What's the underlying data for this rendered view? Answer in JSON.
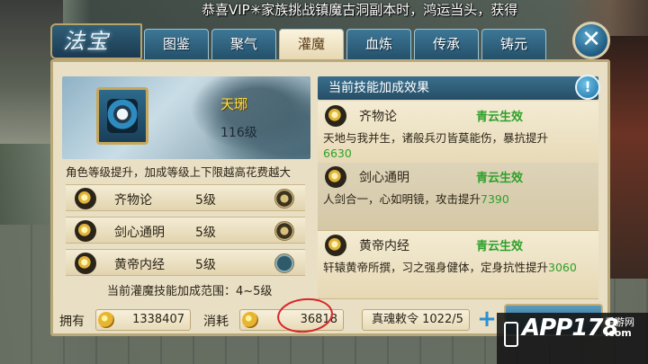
{
  "announcement": "恭喜VIP✳家族挑战镇魔古洞副本时，鸿运当头，获得",
  "logo": "法宝",
  "tabs": [
    {
      "label": "图鉴",
      "active": false
    },
    {
      "label": "聚气",
      "active": false
    },
    {
      "label": "灌魔",
      "active": true
    },
    {
      "label": "血炼",
      "active": false
    },
    {
      "label": "传承",
      "active": false
    },
    {
      "label": "铸元",
      "active": false
    }
  ],
  "close_symbol": "✕",
  "item": {
    "name": "天琊",
    "level": "116级"
  },
  "hint": "角色等级提升，加成等级上下限越高花费越大",
  "skills": [
    {
      "name": "齐物论",
      "level": "5级"
    },
    {
      "name": "剑心通明",
      "level": "5级"
    },
    {
      "name": "黄帝内经",
      "level": "5级"
    }
  ],
  "range_text": "当前灌魔技能加成范围：4~5级",
  "effects_header": "当前技能加成效果",
  "info_symbol": "!",
  "effects": [
    {
      "name": "齐物论",
      "status": "青云生效",
      "desc": "天地与我并生，诸般兵刃皆莫能伤，暴抗提升",
      "value": "6630"
    },
    {
      "name": "剑心通明",
      "status": "青云生效",
      "desc": "人剑合一，心如明镜，攻击提升",
      "value": "7390"
    },
    {
      "name": "黄帝内经",
      "status": "青云生效",
      "desc": "轩辕黄帝所撰，习之强身健体，定身抗性提升",
      "value": "3060"
    }
  ],
  "bottom": {
    "own_label": "拥有",
    "own_value": "1338407",
    "cost_label": "消耗",
    "cost_value": "36818",
    "token_text": "真魂敕令  1022/5",
    "plus_symbol": "+"
  },
  "watermark": {
    "main": "APP178",
    "sub": "手游网",
    "url": ".com"
  },
  "colors": {
    "accent_blue": "#24506a",
    "panel": "#e9dfc4",
    "status_green": "#2fa02a",
    "gold_name": "#ffdf3a",
    "annotation_red": "#d8262a"
  }
}
